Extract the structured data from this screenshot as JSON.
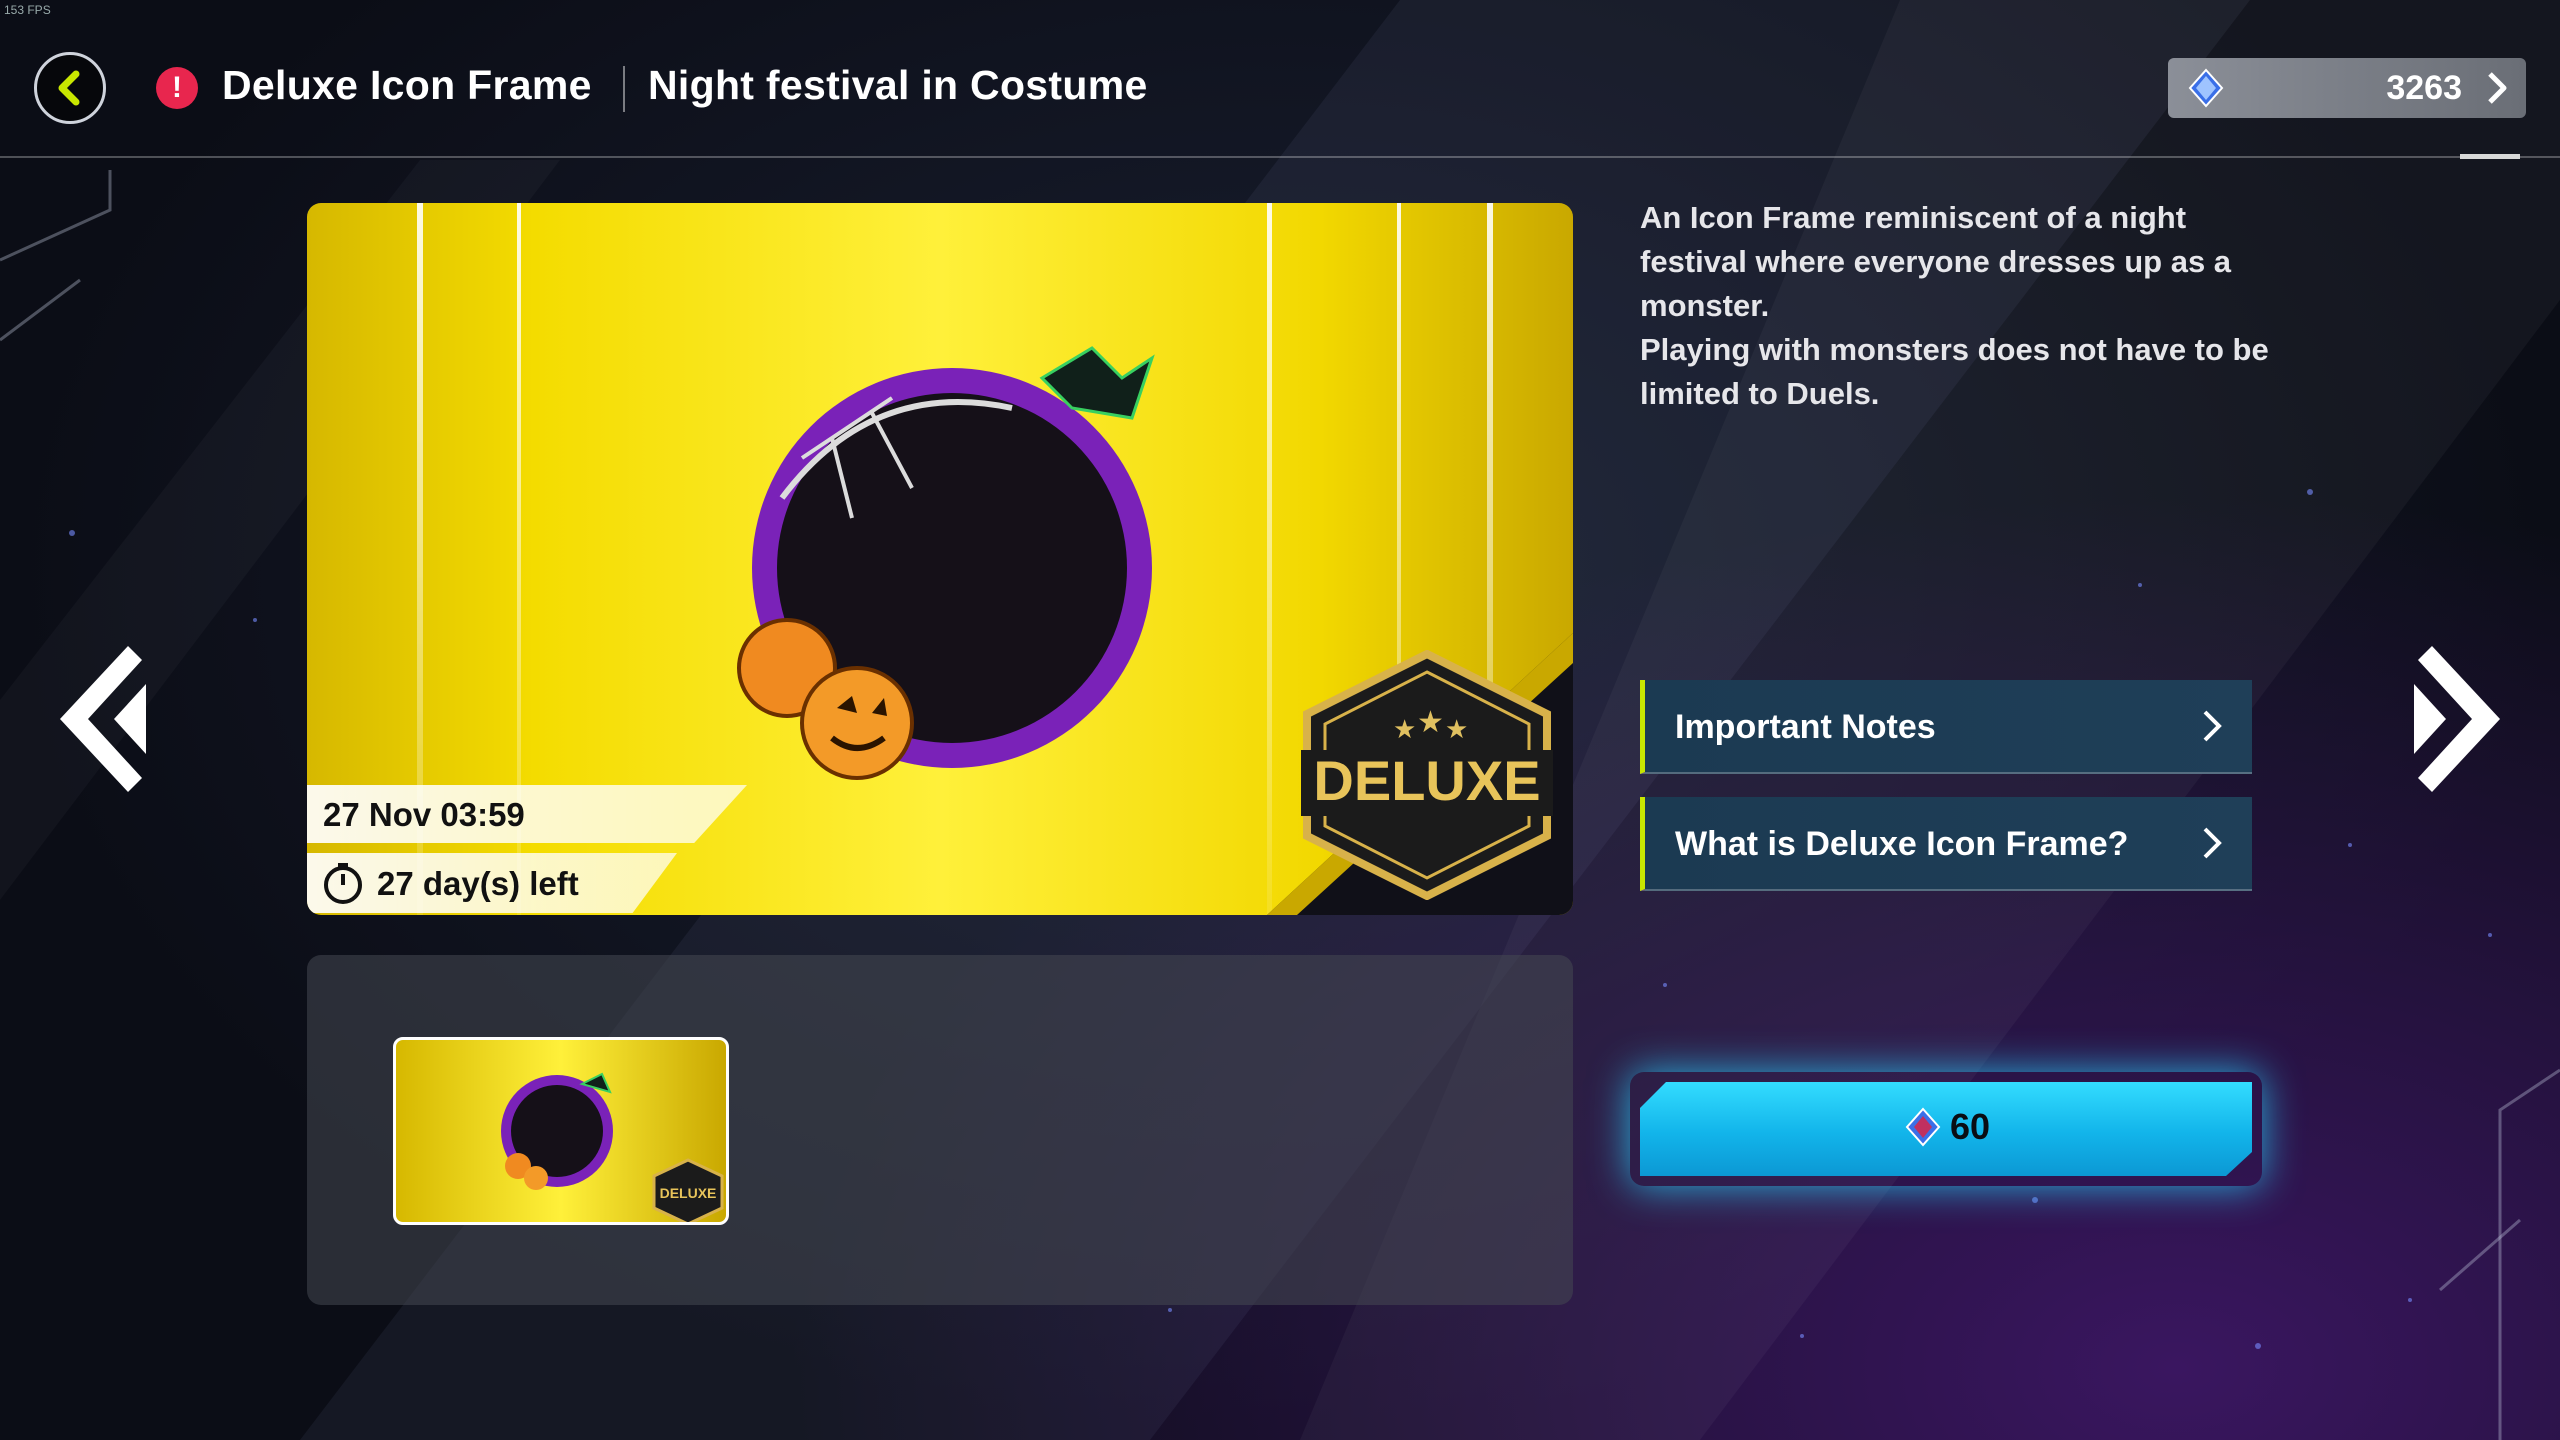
{
  "header": {
    "fps": "153 FPS",
    "title": "Deluxe Icon Frame",
    "subtitle": "Night festival in Costume",
    "currency_value": "3263"
  },
  "preview": {
    "date": "27 Nov 03:59",
    "days_left": "27 day(s) left",
    "badge_text": "DELUXE"
  },
  "thumbnail": {
    "badge_text": "DELUXE"
  },
  "description": {
    "line1": "An Icon Frame reminiscent of a night festival where everyone dresses up as a monster.",
    "line2": "Playing with monsters does not have to be limited to Duels."
  },
  "buttons": {
    "important_notes": "Important Notes",
    "what_is": "What is Deluxe Icon Frame?",
    "price": "60"
  },
  "colors": {
    "accent_green": "#c8e600",
    "buy_cyan": "#12b4ea",
    "alert_red": "#e8264e",
    "gem_blue": "#3a6fe8"
  },
  "icons": [
    "back-arrow-icon",
    "alert-icon",
    "gem-icon",
    "chevron-right-icon",
    "timer-icon",
    "double-chevron-left-icon",
    "double-chevron-right-icon"
  ]
}
